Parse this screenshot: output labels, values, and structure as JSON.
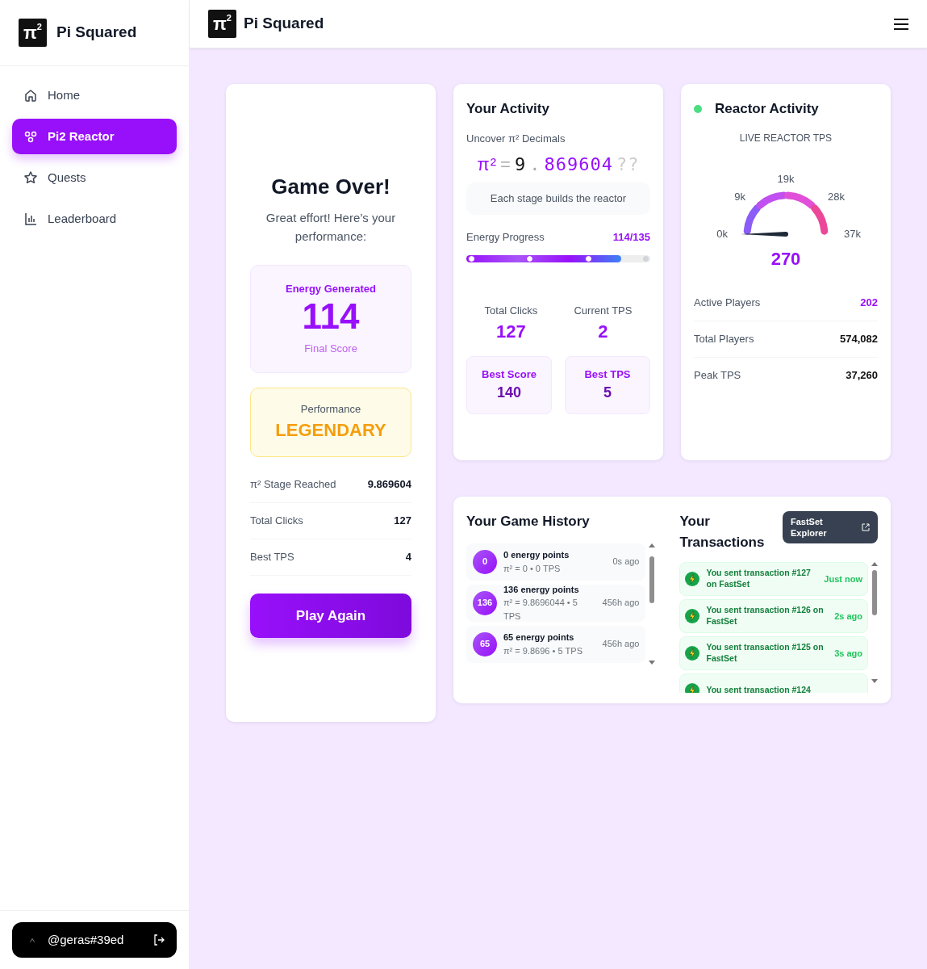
{
  "sidebar": {
    "brand": {
      "logo": "π",
      "logo_sup": "2",
      "name": "Pi Squared"
    },
    "items": [
      {
        "label": "Home",
        "selected": false
      },
      {
        "label": "Pi2 Reactor",
        "selected": true
      },
      {
        "label": "Quests",
        "selected": false
      },
      {
        "label": "Leaderboard",
        "selected": false
      }
    ],
    "user": {
      "handle": "@geras#39ed"
    }
  },
  "header": {
    "logo": "π",
    "logo_sup": "2",
    "name": "Pi Squared"
  },
  "game_over": {
    "title": "Game Over!",
    "subtitle": "Great effort! Here’s your performance:",
    "energy": {
      "label": "Energy Generated",
      "value": "114",
      "caption": "Final Score"
    },
    "performance": {
      "label": "Performance",
      "value": "LEGENDARY"
    },
    "stats": [
      {
        "label": "π² Stage Reached",
        "value": "9.869604"
      },
      {
        "label": "Total Clicks",
        "value": "127"
      },
      {
        "label": "Best TPS",
        "value": "4"
      }
    ],
    "button": "Play Again"
  },
  "activity": {
    "title": "Your Activity",
    "subtitle": "Uncover π² Decimals",
    "pi": {
      "symbol": "π²",
      "equals": "=",
      "integer": "9",
      "point": ".",
      "decimals": "869604",
      "unknown": "??"
    },
    "hint": "Each stage builds the reactor",
    "progress": {
      "label": "Energy Progress",
      "reading": "114/135",
      "level": 0.844,
      "markers": [
        {
          "reached": true
        },
        {
          "reached": true
        },
        {
          "reached": true
        },
        {
          "reached": false
        }
      ]
    },
    "counters": [
      {
        "label": "Total Clicks",
        "value": "127"
      },
      {
        "label": "Current TPS",
        "value": "2"
      }
    ],
    "bests": [
      {
        "label": "Best Score",
        "value": "140"
      },
      {
        "label": "Best TPS",
        "value": "5"
      }
    ]
  },
  "reactor": {
    "title": "Reactor Activity",
    "live": true,
    "gauge_title": "LIVE REACTOR TPS",
    "gauge_ticks": [
      "0k",
      "9k",
      "19k",
      "28k",
      "37k"
    ],
    "value": "270",
    "stats": [
      {
        "label": "Active Players",
        "value": "202",
        "highlight": true
      },
      {
        "label": "Total Players",
        "value": "574,082",
        "highlight": false
      },
      {
        "label": "Peak TPS",
        "value": "37,260",
        "highlight": false
      }
    ]
  },
  "history": {
    "title": "Your Game History",
    "items": [
      {
        "badge": "0",
        "title": "0 energy points",
        "detail": "π² = 0 • 0 TPS",
        "time": "0s ago"
      },
      {
        "badge": "136",
        "title": "136 energy points",
        "detail": "π² = 9.8696044 • 5 TPS",
        "time": "456h ago"
      },
      {
        "badge": "65",
        "title": "65 energy points",
        "detail": "π² = 9.8696 • 5 TPS",
        "time": "456h ago"
      }
    ]
  },
  "transactions": {
    "title": "Your Transactions",
    "explorer_button": "FastSet Explorer",
    "items": [
      {
        "text": "You sent transaction #127 on FastSet",
        "time": "Just now"
      },
      {
        "text": "You sent transaction #126 on FastSet",
        "time": "2s ago"
      },
      {
        "text": "You sent transaction #125 on FastSet",
        "time": "3s ago"
      },
      {
        "text": "You sent transaction #124"
      }
    ]
  }
}
